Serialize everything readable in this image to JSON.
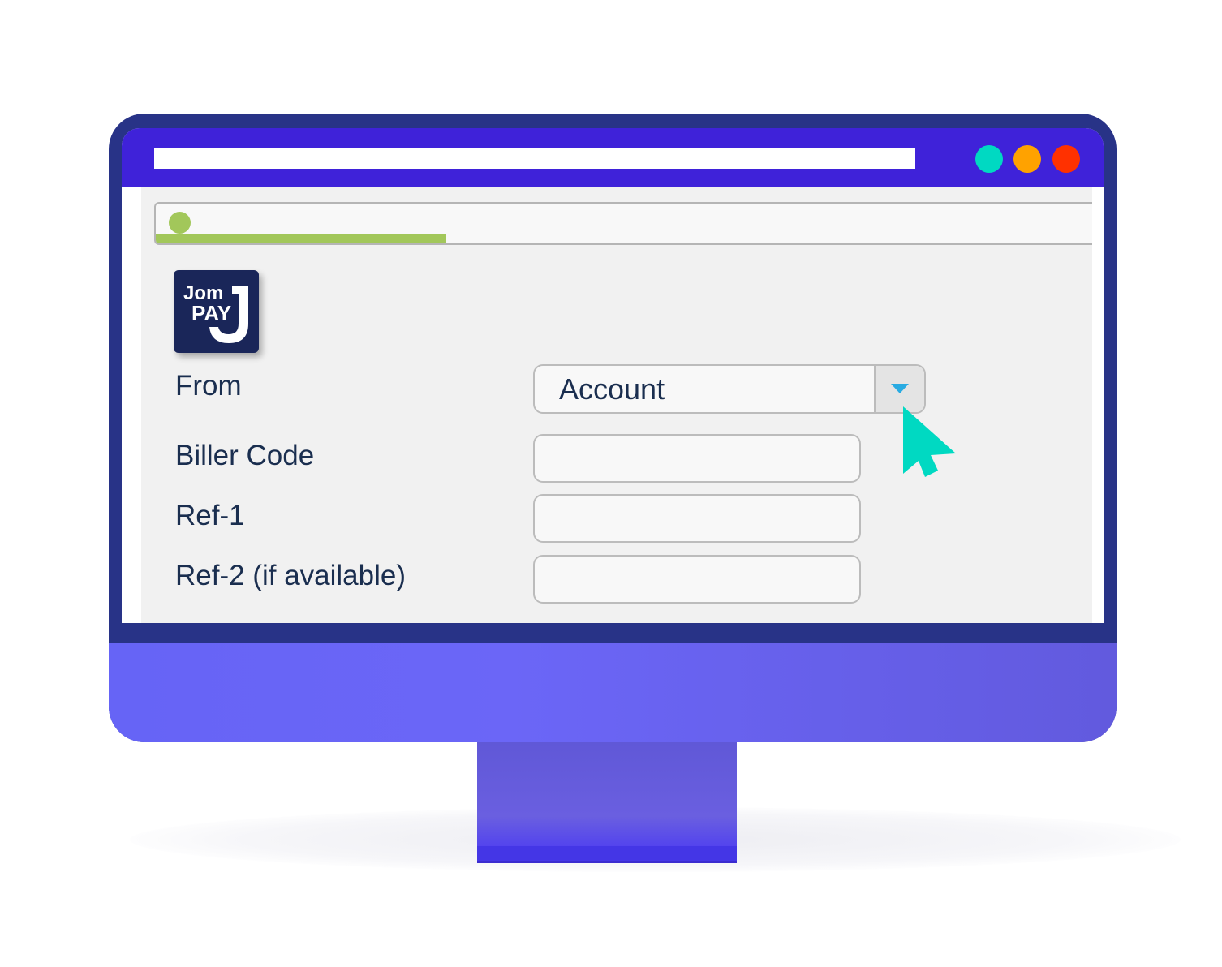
{
  "window": {
    "controls": [
      {
        "name": "minimize",
        "color": "#00d9c2"
      },
      {
        "name": "maximize",
        "color": "#ffa200"
      },
      {
        "name": "close",
        "color": "#ff3100"
      }
    ]
  },
  "progress": {
    "percent": 31,
    "color": "#a2c75a"
  },
  "logo": {
    "line1": "Jom",
    "line2": "PAY"
  },
  "form": {
    "from": {
      "label": "From",
      "value": "Account"
    },
    "biller_code": {
      "label": "Biller Code",
      "value": ""
    },
    "ref1": {
      "label": "Ref-1",
      "value": ""
    },
    "ref2": {
      "label": "Ref-2 (if available)",
      "value": ""
    }
  },
  "colors": {
    "frame": "#283387",
    "titlebar": "#3f22d9",
    "chin": "#6866f4",
    "cursor": "#00d9c2",
    "dropdown_arrow": "#29abe2"
  }
}
